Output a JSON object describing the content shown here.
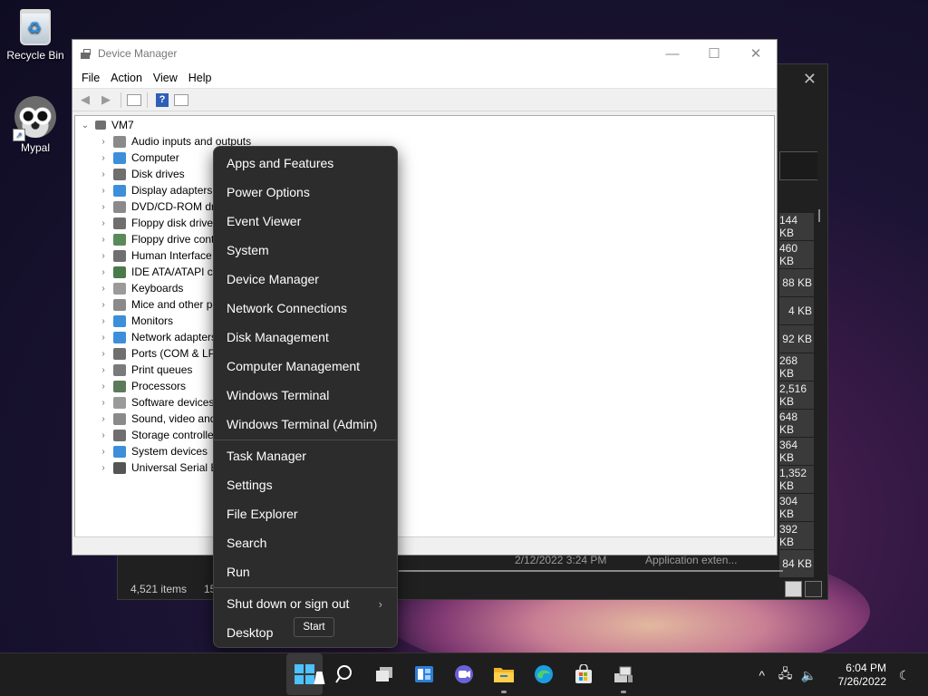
{
  "desktop": {
    "icons": [
      {
        "label": "Recycle Bin",
        "icon": "recycle-bin-icon"
      },
      {
        "label": "Mypal",
        "icon": "raccoon-icon"
      }
    ]
  },
  "explorer": {
    "sizes": [
      "144 KB",
      "460 KB",
      "88 KB",
      "4 KB",
      "92 KB",
      "268 KB",
      "2,516 KB",
      "648 KB",
      "364 KB",
      "1,352 KB",
      "304 KB",
      "392 KB",
      "84 KB"
    ],
    "last_row_date": "2/12/2022 3:24 PM",
    "last_row_type": "Application exten...",
    "status_items": "4,521 items",
    "status_selected": "15"
  },
  "device_manager": {
    "title": "Device Manager",
    "menu": [
      "File",
      "Action",
      "View",
      "Help"
    ],
    "root": "VM7",
    "nodes": [
      {
        "label": "Audio inputs and outputs",
        "color": "#8a8a8a"
      },
      {
        "label": "Computer",
        "color": "#3c8fd8"
      },
      {
        "label": "Disk drives",
        "color": "#6f6f6f"
      },
      {
        "label": "Display adapters",
        "color": "#3c8fd8"
      },
      {
        "label": "DVD/CD-ROM dri",
        "color": "#8a8a8a"
      },
      {
        "label": "Floppy disk drives",
        "color": "#6f6f6f"
      },
      {
        "label": "Floppy drive cont",
        "color": "#5a8a5a"
      },
      {
        "label": "Human Interface",
        "color": "#6f6f6f"
      },
      {
        "label": "IDE ATA/ATAPI co",
        "color": "#4a7a4a"
      },
      {
        "label": "Keyboards",
        "color": "#9a9a9a"
      },
      {
        "label": "Mice and other po",
        "color": "#8a8a8a"
      },
      {
        "label": "Monitors",
        "color": "#3c8fd8"
      },
      {
        "label": "Network adapters",
        "color": "#3c8fd8"
      },
      {
        "label": "Ports (COM & LP",
        "color": "#6f6f6f"
      },
      {
        "label": "Print queues",
        "color": "#7a7a7a"
      },
      {
        "label": "Processors",
        "color": "#5a7a5a"
      },
      {
        "label": "Software devices",
        "color": "#9a9a9a"
      },
      {
        "label": "Sound, video and",
        "color": "#8a8a8a"
      },
      {
        "label": "Storage controlle",
        "color": "#6f6f6f"
      },
      {
        "label": "System devices",
        "color": "#3c8fd8"
      },
      {
        "label": "Universal Serial Bu",
        "color": "#555555"
      }
    ]
  },
  "context_menu": {
    "group1": [
      "Apps and Features",
      "Power Options",
      "Event Viewer",
      "System",
      "Device Manager",
      "Network Connections",
      "Disk Management",
      "Computer Management",
      "Windows Terminal",
      "Windows Terminal (Admin)"
    ],
    "group2": [
      "Task Manager",
      "Settings",
      "File Explorer",
      "Search",
      "Run"
    ],
    "shutdown": "Shut down or sign out",
    "desktop": "Desktop",
    "tooltip": "Start"
  },
  "taskbar": {
    "apps": [
      "start-icon",
      "search-icon",
      "task-view-icon",
      "widgets-icon",
      "chat-icon",
      "file-explorer-icon",
      "edge-icon",
      "store-icon",
      "device-manager-icon"
    ],
    "time": "6:04 PM",
    "date": "7/26/2022"
  },
  "colors": {
    "accent": "#4cc2ff",
    "menu_bg": "#2c2c2c",
    "taskbar_bg": "#1e1e1e"
  }
}
